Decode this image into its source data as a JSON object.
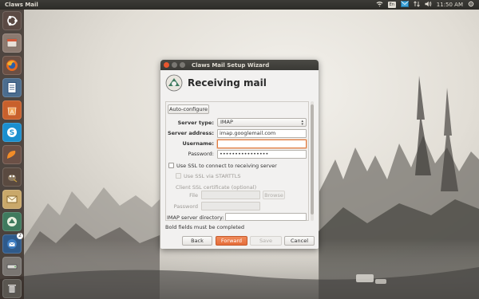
{
  "topbar": {
    "app_title": "Claws Mail",
    "keyboard_layout": "En",
    "clock": "11:50 AM"
  },
  "launcher": {
    "items": [
      {
        "icon": "ubuntu-dash-icon"
      },
      {
        "icon": "files-icon"
      },
      {
        "icon": "firefox-icon"
      },
      {
        "icon": "libreoffice-writer-icon"
      },
      {
        "icon": "software-center-icon"
      },
      {
        "icon": "skype-icon"
      },
      {
        "icon": "orange-app-icon"
      },
      {
        "icon": "gimp-icon"
      },
      {
        "icon": "mail-stack-icon"
      },
      {
        "icon": "claws-mail-icon"
      },
      {
        "icon": "thunderbird-icon",
        "badge": "2"
      },
      {
        "icon": "drive-icon"
      },
      {
        "icon": "trash-icon"
      }
    ]
  },
  "dialog": {
    "title": "Claws Mail Setup Wizard",
    "heading": "Receiving mail",
    "auto_configure": "Auto-configure",
    "server_type_label": "Server type:",
    "server_type_value": "IMAP",
    "server_address_label": "Server address:",
    "server_address_value": "imap.googlemail.com",
    "username_label": "Username:",
    "username_value": "",
    "password_label": "Password:",
    "password_value": "••••••••••••••••",
    "use_ssl_label": "Use SSL to connect to receiving server",
    "use_ssl_starttls_label": "Use SSL via STARTTLS",
    "client_ssl_cert_label": "Client SSL certificate (optional)",
    "file_label": "File",
    "browse_label": "Browse",
    "cert_password_label": "Password",
    "imap_dir_label": "IMAP server directory:",
    "imap_dir_value": "",
    "bold_fields_note": "Bold fields must be completed",
    "back_label": "Back",
    "forward_label": "Forward",
    "save_label": "Save",
    "cancel_label": "Cancel"
  },
  "colors": {
    "accent": "#e56d3a",
    "titlebar": "#3c3b37",
    "dialog_bg": "#f2f1f0"
  }
}
